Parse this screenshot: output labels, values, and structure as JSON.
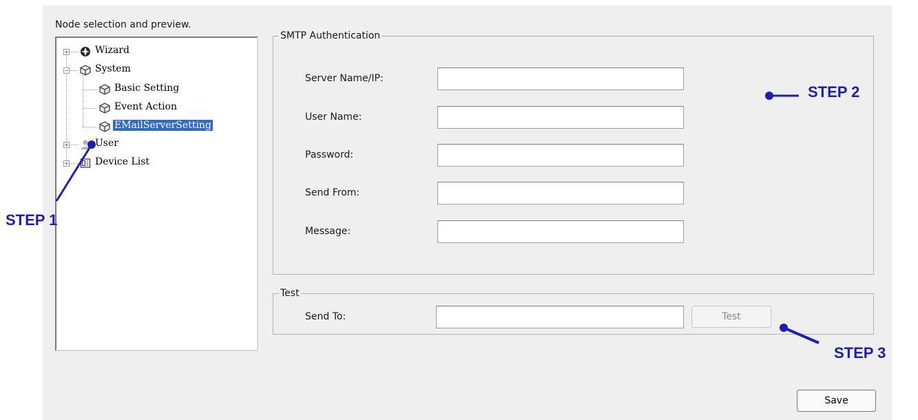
{
  "tree_panel": {
    "heading": "Node selection and preview.",
    "nodes": [
      {
        "label": "Wizard",
        "icon": "wizard-icon"
      },
      {
        "label": "System",
        "icon": "cube-icon"
      },
      {
        "label": "Basic Setting",
        "icon": "cube-icon"
      },
      {
        "label": "Event Action",
        "icon": "cube-icon"
      },
      {
        "label": "EMailServerSetting",
        "icon": "cube-icon",
        "selected": true
      },
      {
        "label": "User",
        "icon": "user-icon"
      },
      {
        "label": "Device List",
        "icon": "device-list-icon"
      }
    ],
    "expander_plus": "+",
    "expander_minus": "−"
  },
  "smtp": {
    "title": "SMTP Authentication",
    "fields": [
      {
        "label": "Server Name/IP:",
        "value": ""
      },
      {
        "label": "User Name:",
        "value": ""
      },
      {
        "label": "Password:",
        "value": ""
      },
      {
        "label": "Send From:",
        "value": ""
      },
      {
        "label": "Message:",
        "value": ""
      }
    ]
  },
  "test": {
    "title": "Test",
    "send_to_label": "Send To:",
    "send_to_value": "",
    "button_label": "Test"
  },
  "save_label": "Save",
  "annotations": {
    "step1": "STEP 1",
    "step2": "STEP 2",
    "step3": "STEP 3",
    "color": "#1d1db8"
  }
}
